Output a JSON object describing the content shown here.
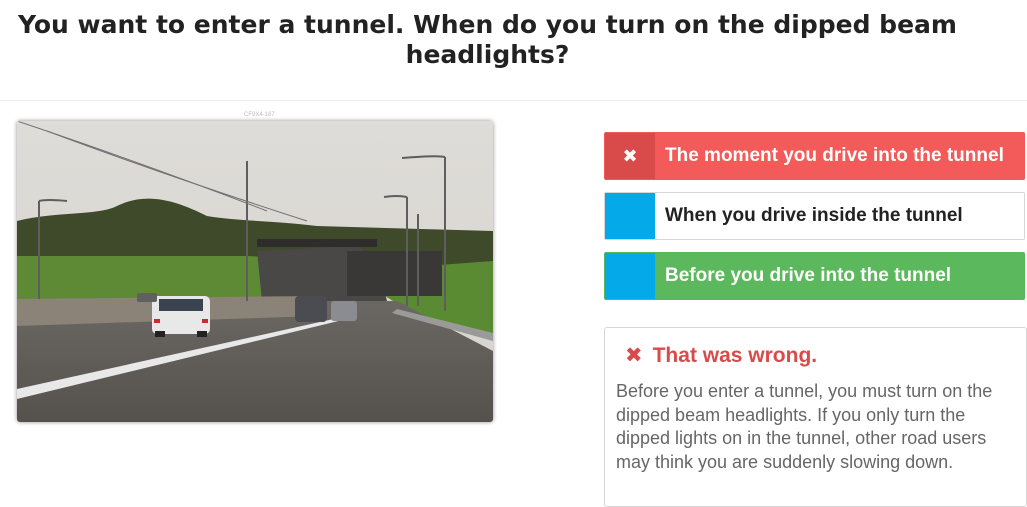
{
  "question": "You want to enter a tunnel. When do you turn on the dipped beam headlights?",
  "image_id": "CF9X4-187",
  "answers": [
    {
      "label": "The moment you drive into the tunnel",
      "state": "wrong",
      "marker": "✖"
    },
    {
      "label": "When you drive inside the tunnel",
      "state": "neutral",
      "marker": ""
    },
    {
      "label": "Before you drive into the tunnel",
      "state": "correct",
      "marker": ""
    }
  ],
  "feedback": {
    "icon": "close-icon",
    "title": "That was wrong.",
    "text": "Before you enter a tunnel, you must turn on the dipped beam headlights. If you only turn the dipped lights on in the tunnel, other road users may think you are suddenly slowing down."
  },
  "colors": {
    "wrong": "#f25b59",
    "wrong_marker": "#d94a4a",
    "correct": "#5cb85c",
    "marker_blue": "#03a9e8"
  }
}
